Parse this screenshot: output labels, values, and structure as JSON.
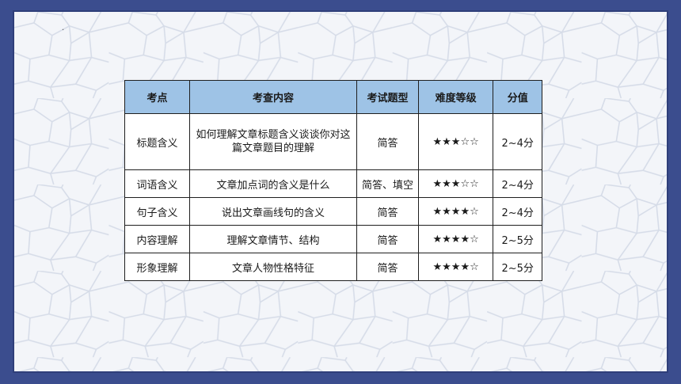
{
  "table": {
    "headers": [
      "考点",
      "考查内容",
      "考试题型",
      "难度等级",
      "分值"
    ],
    "rows": [
      {
        "topic": "标题含义",
        "content": "如何理解文章标题含义谈谈你对这篇文章题目的理解",
        "type": "简答",
        "difficulty": "★★★☆☆",
        "score": "2~4分"
      },
      {
        "topic": "词语含义",
        "content": "文章加点词的含义是什么",
        "type": "简答、填空",
        "difficulty": "★★★☆☆",
        "score": "2~4分"
      },
      {
        "topic": "句子含义",
        "content": "说出文章画线句的含义",
        "type": "简答",
        "difficulty": "★★★★☆",
        "score": "2~4分"
      },
      {
        "topic": "内容理解",
        "content": "理解文章情节、结构",
        "type": "简答",
        "difficulty": "★★★★☆",
        "score": "2~5分"
      },
      {
        "topic": "形象理解",
        "content": "文章人物性格特征",
        "type": "简答",
        "difficulty": "★★★★☆",
        "score": "2~5分"
      }
    ]
  },
  "colors": {
    "frame": "#3b4d8e",
    "header_bg": "#9ec3e6",
    "slide_bg": "#f3f5f9"
  }
}
